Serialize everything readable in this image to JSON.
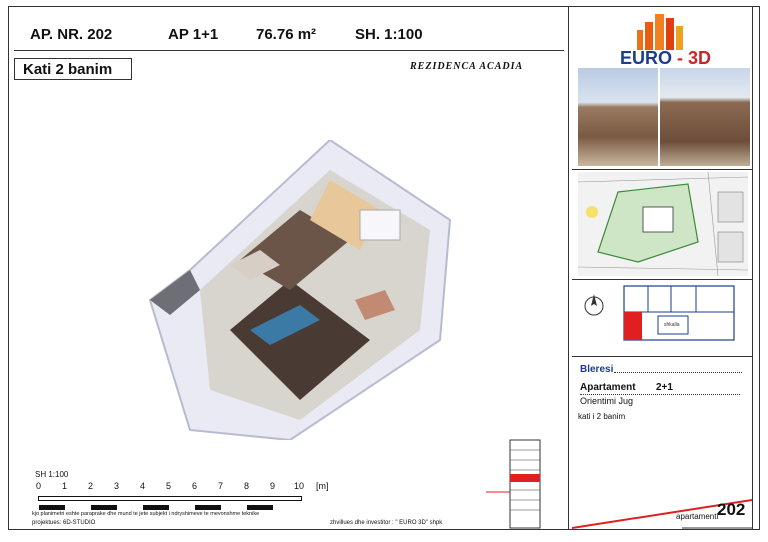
{
  "header": {
    "apartment_no": "AP. NR. 202",
    "apartment_type": "AP 1+1",
    "area": "76.76 m²",
    "scale": "SH. 1:100"
  },
  "floor_label": "Kati 2 banim",
  "residence_name": "REZIDENCA ACADIA",
  "logo": {
    "part1": "EURO",
    "part2": "- 3D"
  },
  "buyer": {
    "label": "Bleresi"
  },
  "apartment_info": {
    "label": "Apartament",
    "type": "2+1",
    "orientation": "Orientimi Jug",
    "floor": "kati i 2 banim"
  },
  "footer": {
    "apartment_label": "apartamenti",
    "apartment_number": "202",
    "note": "kjo planimetri eshte paraprake dhe mund te jete subjekt i ndryshimeve te mevonshme teknike",
    "designer": "projektues: 6D-STUDIO",
    "investor": "zhvillues dhe investitor : \" EURO 3D\" shpk"
  },
  "scale_bar": {
    "label": "SH 1:100",
    "ticks": [
      "0",
      "1",
      "2",
      "3",
      "4",
      "5",
      "6",
      "7",
      "8",
      "9",
      "10"
    ],
    "unit": "[m]"
  },
  "keyplan": {
    "label": "shkalla"
  },
  "colors": {
    "brand_blue": "#1a3e8c",
    "brand_red": "#c62828",
    "highlight": "#e02020"
  }
}
